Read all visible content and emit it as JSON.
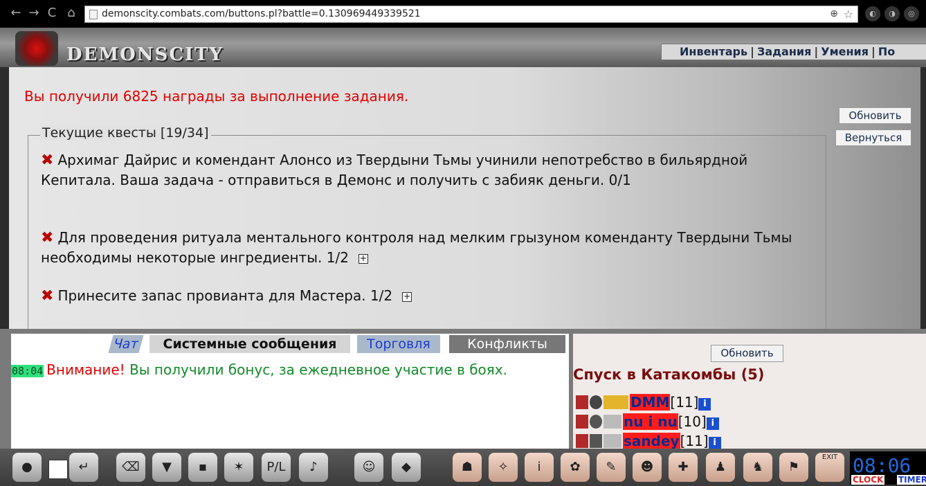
{
  "browser": {
    "url": "demonscity.combats.com/buttons.pl?battle=0.130969449339521",
    "back": "←",
    "forward": "→",
    "reload": "C",
    "home": "⌂"
  },
  "header": {
    "logo_text": "DEMONSCITY",
    "menu": [
      "Инвентарь",
      "Задания",
      "Умения",
      "По"
    ]
  },
  "main": {
    "reward_message": "Вы получили 6825 награды за выполнение задания.",
    "refresh_label": "Обновить",
    "back_label": "Вернуться",
    "quests_title": "Текущие квесты [19/34]",
    "quests": [
      {
        "text": "Архимаг Дайрис и комендант Алонсо из Твердыни Тьмы учинили непотребство в бильярдной Кепитала. Ваша задача - отправиться в Демонс и получить с забияк деньги. 0/1",
        "expand": ""
      },
      {
        "text": "Для проведения ритуала ментального контроля над мелким грызуном коменданту Твердыни Тьмы необходимы некоторые ингредиенты. 1/2",
        "expand": "+"
      },
      {
        "text": "Принесите запас провианта для Мастера. 1/2",
        "expand": "+"
      }
    ]
  },
  "chat": {
    "tabs": [
      "Чат",
      "Системные сообщения",
      "Торговля",
      "Конфликты"
    ],
    "active_tab": "Системные сообщения",
    "message": {
      "time": "08:04",
      "alert": "Внимание!",
      "text": "Вы получили бонус, за ежедневное участие в боях."
    }
  },
  "right_panel": {
    "refresh_label": "Обновить",
    "title": "Спуск в Катакомбы (5)",
    "players": [
      {
        "name": "DMM",
        "level": "[11]",
        "info": "i"
      },
      {
        "name": "nu i nu",
        "level": "[10]",
        "info": "i"
      },
      {
        "name": "sandey",
        "level": "[11]",
        "info": "i"
      }
    ]
  },
  "toolbar": {
    "tools": [
      "chat-tool",
      "enter-tool",
      "clear-tool",
      "filter-tool",
      "save-tool",
      "fight-tool",
      "pl-tool",
      "sound-tool",
      "smile-tool",
      "helmet-tool"
    ],
    "nav": [
      "character",
      "compass",
      "inventory",
      "gems",
      "tools",
      "mask",
      "cross",
      "group",
      "party",
      "flag",
      "exit"
    ],
    "exit_label": "EXIT",
    "pl_label": "P/L",
    "clock_time": "08:06",
    "clock_label": "CLOCK",
    "timer_label": "TIMER"
  },
  "colors": {
    "reward": "#e20000",
    "chat_green": "#138a2a",
    "player_highlight": "#ff1c1c",
    "panel_title": "#7a0e0e"
  }
}
